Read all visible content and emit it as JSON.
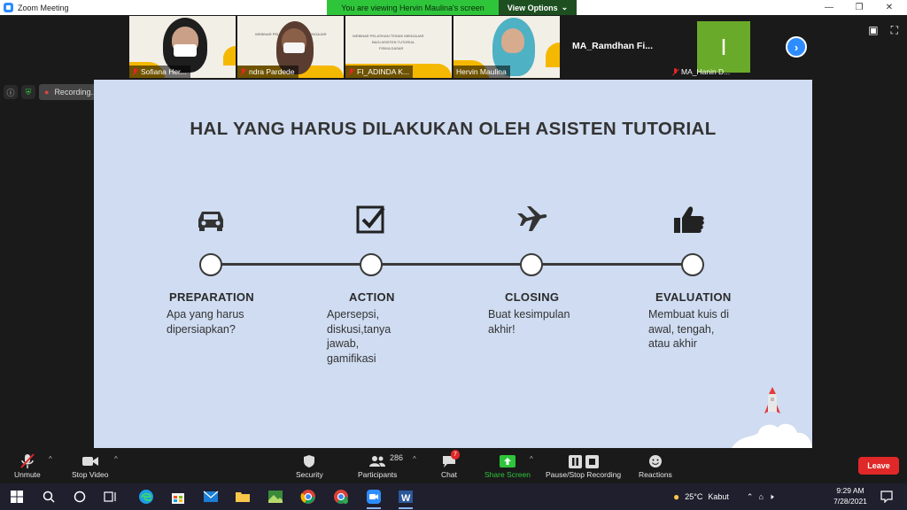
{
  "window": {
    "title": "Zoom Meeting"
  },
  "banner": {
    "viewing": "You are viewing Hervin Maulina's screen",
    "view_options": "View Options"
  },
  "participants_strip": [
    {
      "name": "Sofiana Her...",
      "muted": true
    },
    {
      "name": "ndra Pardede",
      "muted": true
    },
    {
      "name": "FI_ADINDA K...",
      "muted": true
    },
    {
      "name": "Hervin Maulina",
      "muted": false
    },
    {
      "name": "MA_Ramdhan  Fi...",
      "muted": false
    },
    {
      "name": "MA_Hanin D...",
      "muted": true,
      "initial": "I"
    }
  ],
  "thumb_slide_text": {
    "t1": "WEBINAR PELATIHAN TEKNIK MENGAJAR",
    "t2": "BAGI ASISTEN TUTORIAL",
    "t3": "FISIKA DASAR"
  },
  "recording": {
    "label": "Recording..."
  },
  "slide": {
    "title": "HAL YANG HARUS DILAKUKAN OLEH ASISTEN TUTORIAL",
    "stages": [
      {
        "label": "PREPARATION",
        "desc_lines": [
          "Apa yang harus",
          "dipersiapkan?"
        ],
        "icon": "car-icon"
      },
      {
        "label": "ACTION",
        "desc_lines": [
          "Apersepsi,",
          "diskusi,tanya",
          "jawab,",
          "gamifikasi"
        ],
        "icon": "checkbox-icon"
      },
      {
        "label": "CLOSING",
        "desc_lines": [
          "Buat kesimpulan",
          "akhir!"
        ],
        "icon": "airplane-icon"
      },
      {
        "label": "EVALUATION",
        "desc_lines": [
          "Membuat kuis di",
          "awal, tengah,",
          "atau akhir"
        ],
        "icon": "thumbs-up-icon"
      }
    ]
  },
  "toolbar": {
    "unmute": "Unmute",
    "stop_video": "Stop Video",
    "security": "Security",
    "participants": "Participants",
    "participants_count": "286",
    "chat": "Chat",
    "chat_badge": "7",
    "share_screen": "Share Screen",
    "pause_stop_recording": "Pause/Stop Recording",
    "reactions": "Reactions",
    "leave": "Leave"
  },
  "taskbar": {
    "weather_temp": "25°C",
    "weather_desc": "Kabut",
    "time": "9:29 AM",
    "date": "7/28/2021"
  },
  "colors": {
    "zoom_blue": "#2d8cff",
    "banner_green": "#2fc53b",
    "slide_bg": "#cfdcf1",
    "leave_red": "#e02828"
  }
}
